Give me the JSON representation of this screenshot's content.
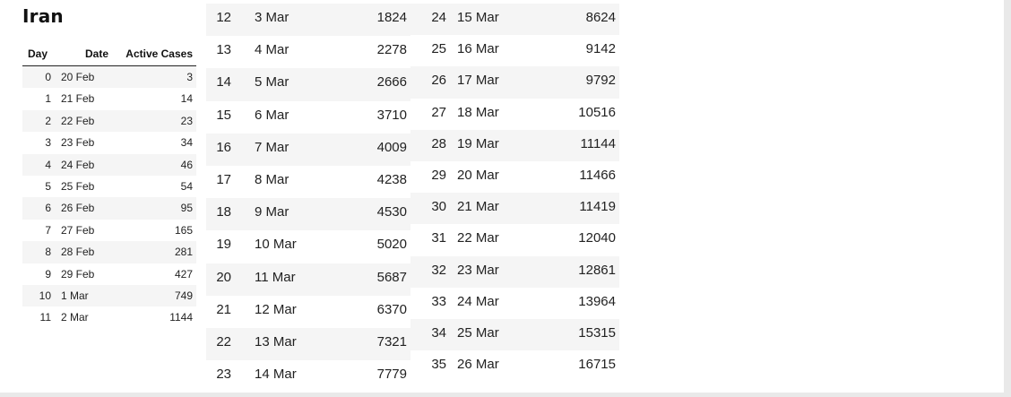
{
  "title": "Iran",
  "table1": {
    "headers": {
      "day": "Day",
      "date": "Date",
      "active": "Active Cases"
    },
    "rows": [
      {
        "day": "0",
        "date": "20 Feb",
        "active": "3"
      },
      {
        "day": "1",
        "date": "21 Feb",
        "active": "14"
      },
      {
        "day": "2",
        "date": "22 Feb",
        "active": "23"
      },
      {
        "day": "3",
        "date": "23 Feb",
        "active": "34"
      },
      {
        "day": "4",
        "date": "24 Feb",
        "active": "46"
      },
      {
        "day": "5",
        "date": "25 Feb",
        "active": "54"
      },
      {
        "day": "6",
        "date": "26 Feb",
        "active": "95"
      },
      {
        "day": "7",
        "date": "27 Feb",
        "active": "165"
      },
      {
        "day": "8",
        "date": "28 Feb",
        "active": "281"
      },
      {
        "day": "9",
        "date": "29 Feb",
        "active": "427"
      },
      {
        "day": "10",
        "date": "1 Mar",
        "active": "749"
      },
      {
        "day": "11",
        "date": "2 Mar",
        "active": "1144"
      }
    ]
  },
  "table2": {
    "rows": [
      {
        "day": "12",
        "date": "3 Mar",
        "active": "1824"
      },
      {
        "day": "13",
        "date": "4 Mar",
        "active": "2278"
      },
      {
        "day": "14",
        "date": "5 Mar",
        "active": "2666"
      },
      {
        "day": "15",
        "date": "6 Mar",
        "active": "3710"
      },
      {
        "day": "16",
        "date": "7 Mar",
        "active": "4009"
      },
      {
        "day": "17",
        "date": "8 Mar",
        "active": "4238"
      },
      {
        "day": "18",
        "date": "9 Mar",
        "active": "4530"
      },
      {
        "day": "19",
        "date": "10 Mar",
        "active": "5020"
      },
      {
        "day": "20",
        "date": "11 Mar",
        "active": "5687"
      },
      {
        "day": "21",
        "date": "12 Mar",
        "active": "6370"
      },
      {
        "day": "22",
        "date": "13 Mar",
        "active": "7321"
      },
      {
        "day": "23",
        "date": "14 Mar",
        "active": "7779"
      }
    ]
  },
  "table3": {
    "rows": [
      {
        "day": "24",
        "date": "15 Mar",
        "active": "8624"
      },
      {
        "day": "25",
        "date": "16 Mar",
        "active": "9142"
      },
      {
        "day": "26",
        "date": "17 Mar",
        "active": "9792"
      },
      {
        "day": "27",
        "date": "18 Mar",
        "active": "10516"
      },
      {
        "day": "28",
        "date": "19 Mar",
        "active": "11144"
      },
      {
        "day": "29",
        "date": "20 Mar",
        "active": "11466"
      },
      {
        "day": "30",
        "date": "21 Mar",
        "active": "11419"
      },
      {
        "day": "31",
        "date": "22 Mar",
        "active": "12040"
      },
      {
        "day": "32",
        "date": "23 Mar",
        "active": "12861"
      },
      {
        "day": "33",
        "date": "24 Mar",
        "active": "13964"
      },
      {
        "day": "34",
        "date": "25 Mar",
        "active": "15315"
      },
      {
        "day": "35",
        "date": "26 Mar",
        "active": "16715"
      }
    ]
  }
}
